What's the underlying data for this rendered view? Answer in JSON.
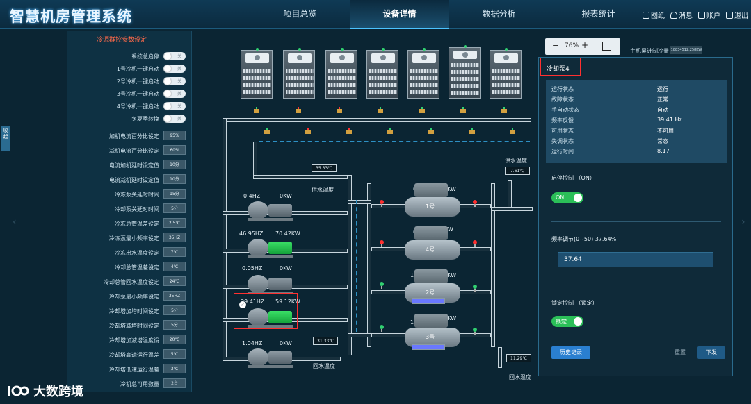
{
  "app": {
    "title": "智慧机房管理系统"
  },
  "nav": [
    {
      "label": "项目总览",
      "active": false
    },
    {
      "label": "设备详情",
      "active": true
    },
    {
      "label": "数据分析",
      "active": false
    },
    {
      "label": "报表统计",
      "active": false
    }
  ],
  "header_actions": [
    {
      "label": "图纸",
      "icon": "blueprint-icon"
    },
    {
      "label": "消息",
      "icon": "bell-icon"
    },
    {
      "label": "账户",
      "icon": "home-icon"
    },
    {
      "label": "退出",
      "icon": "exit-icon"
    }
  ],
  "left_panel": {
    "title": "冷源群控参数设定",
    "toggles": [
      {
        "label": "系统总启停",
        "state": "关"
      },
      {
        "label": "1号冷机一键启动",
        "state": "关"
      },
      {
        "label": "2号冷机一键启动",
        "state": "关"
      },
      {
        "label": "3号冷机一键启动",
        "state": "关"
      },
      {
        "label": "4号冷机一键启动",
        "state": "关"
      },
      {
        "label": "冬夏季转换",
        "state": "关"
      }
    ],
    "params": [
      {
        "label": "加机电流百分比设定",
        "value": "95%"
      },
      {
        "label": "减机电流百分比设定",
        "value": "60%"
      },
      {
        "label": "电流加机延时设定值",
        "value": "10分"
      },
      {
        "label": "电流减机延时设定值",
        "value": "10分"
      },
      {
        "label": "冷冻泵关延时时间",
        "value": "15分"
      },
      {
        "label": "冷却泵关延时时间",
        "value": "5分"
      },
      {
        "label": "冷冻总管温差设定",
        "value": "2.5℃"
      },
      {
        "label": "冷冻泵最小频率设定",
        "value": "35HZ"
      },
      {
        "label": "冷冻出水温度设定",
        "value": "7℃"
      },
      {
        "label": "冷却总管温差设定",
        "value": "4℃"
      },
      {
        "label": "冷却总管回水温度设定",
        "value": "24℃"
      },
      {
        "label": "冷却泵最小频率设定",
        "value": "35HZ"
      },
      {
        "label": "冷却塔加塔时间设定",
        "value": "5分"
      },
      {
        "label": "冷却塔减塔时间设定",
        "value": "5分"
      },
      {
        "label": "冷却塔加减塔温度设",
        "value": "20℃"
      },
      {
        "label": "冷却塔高速运行温差",
        "value": "5℃"
      },
      {
        "label": "冷却塔低速运行温差",
        "value": "3℃"
      },
      {
        "label": "冷机总可用数量",
        "value": "2台"
      }
    ]
  },
  "side_tab": {
    "label": "收起"
  },
  "diagram": {
    "supply_temp_top": {
      "value": "35.33℃",
      "label": "供水温度"
    },
    "return_temp_bottom": {
      "value": "31.33℃",
      "label": "回水温度"
    },
    "supply_temp_right": {
      "value": "7.61℃",
      "label": "供水温度"
    },
    "return_temp_right": {
      "value": "11.29℃",
      "label": "回水温度"
    },
    "pumps": [
      {
        "freq": "0.4HZ",
        "power": "0KW",
        "running": false
      },
      {
        "freq": "46.95HZ",
        "power": "70.42KW",
        "running": true
      },
      {
        "freq": "0.05HZ",
        "power": "0KW",
        "running": false
      },
      {
        "freq": "39.41HZ",
        "power": "59.12KW",
        "running": true
      },
      {
        "freq": "1.04HZ",
        "power": "0KW",
        "running": false
      }
    ],
    "chillers": [
      {
        "num": "1号",
        "load": "0%",
        "power": "0KW",
        "fill": 0
      },
      {
        "num": "4号",
        "load": "0%",
        "power": "1KW",
        "fill": 0
      },
      {
        "num": "2号",
        "load": "102%",
        "power": "450KW",
        "fill": 1.0
      },
      {
        "num": "3号",
        "load": "100%",
        "power": "507KW",
        "fill": 1.0
      }
    ]
  },
  "zoom": {
    "value": "76%"
  },
  "host_plan": {
    "label": "主机累计制冷量",
    "value": "18834512.258KW"
  },
  "popup": {
    "title": "冷却泵4",
    "status": [
      {
        "k": "运行状态",
        "v": "运行"
      },
      {
        "k": "故障状态",
        "v": "正常"
      },
      {
        "k": "手自动状态",
        "v": "自动"
      },
      {
        "k": "频率反馈",
        "v": "39.41 Hz"
      },
      {
        "k": "可用状态",
        "v": "不可用"
      },
      {
        "k": "失调状态",
        "v": "常态"
      },
      {
        "k": "运行时间",
        "v": "8.17"
      }
    ],
    "start_stop": {
      "label": "启停控制 （ON）",
      "toggle": "ON"
    },
    "freq_adjust": {
      "label": "频率调节(0~50) 37.64%",
      "value": "37.64"
    },
    "lock": {
      "label": "锁定控制 （锁定）",
      "toggle": "锁定"
    },
    "buttons": {
      "history": "历史记录",
      "reset": "重置",
      "submit": "下发"
    }
  },
  "watermark": {
    "text": "大数跨境"
  }
}
